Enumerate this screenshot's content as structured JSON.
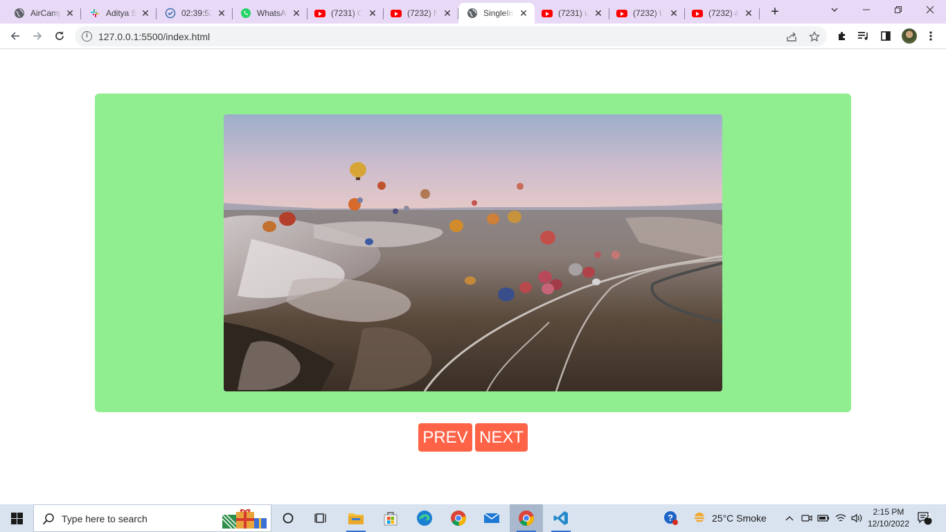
{
  "browser": {
    "tabs": [
      {
        "label": "AirCamp",
        "icon": "globe-icon",
        "active": false
      },
      {
        "label": "Aditya S",
        "icon": "slack-icon",
        "active": false
      },
      {
        "label": "02:39:52",
        "icon": "check-circle-icon",
        "active": false
      },
      {
        "label": "WhatsApp",
        "icon": "whatsapp-icon",
        "active": false
      },
      {
        "label": "(7231) C",
        "icon": "youtube-icon",
        "active": false
      },
      {
        "label": "(7232) N",
        "icon": "youtube-icon",
        "active": false
      },
      {
        "label": "SingleIm",
        "icon": "globe-icon",
        "active": true
      },
      {
        "label": "(7231) u",
        "icon": "youtube-icon",
        "active": false
      },
      {
        "label": "(7232) U",
        "icon": "youtube-icon",
        "active": false
      },
      {
        "label": "(7232) #",
        "icon": "youtube-icon",
        "active": false
      }
    ],
    "new_tab": "+",
    "close_glyph": "✕",
    "url": "127.0.0.1:5500/index.html"
  },
  "page": {
    "prev_label": "PREV",
    "next_label": "NEXT",
    "card_color": "#90ee90",
    "button_color": "#ff6347"
  },
  "taskbar": {
    "search_placeholder": "Type here to search",
    "weather": "25°C  Smoke",
    "time": "2:15 PM",
    "date": "12/10/2022",
    "notifications": "2"
  }
}
